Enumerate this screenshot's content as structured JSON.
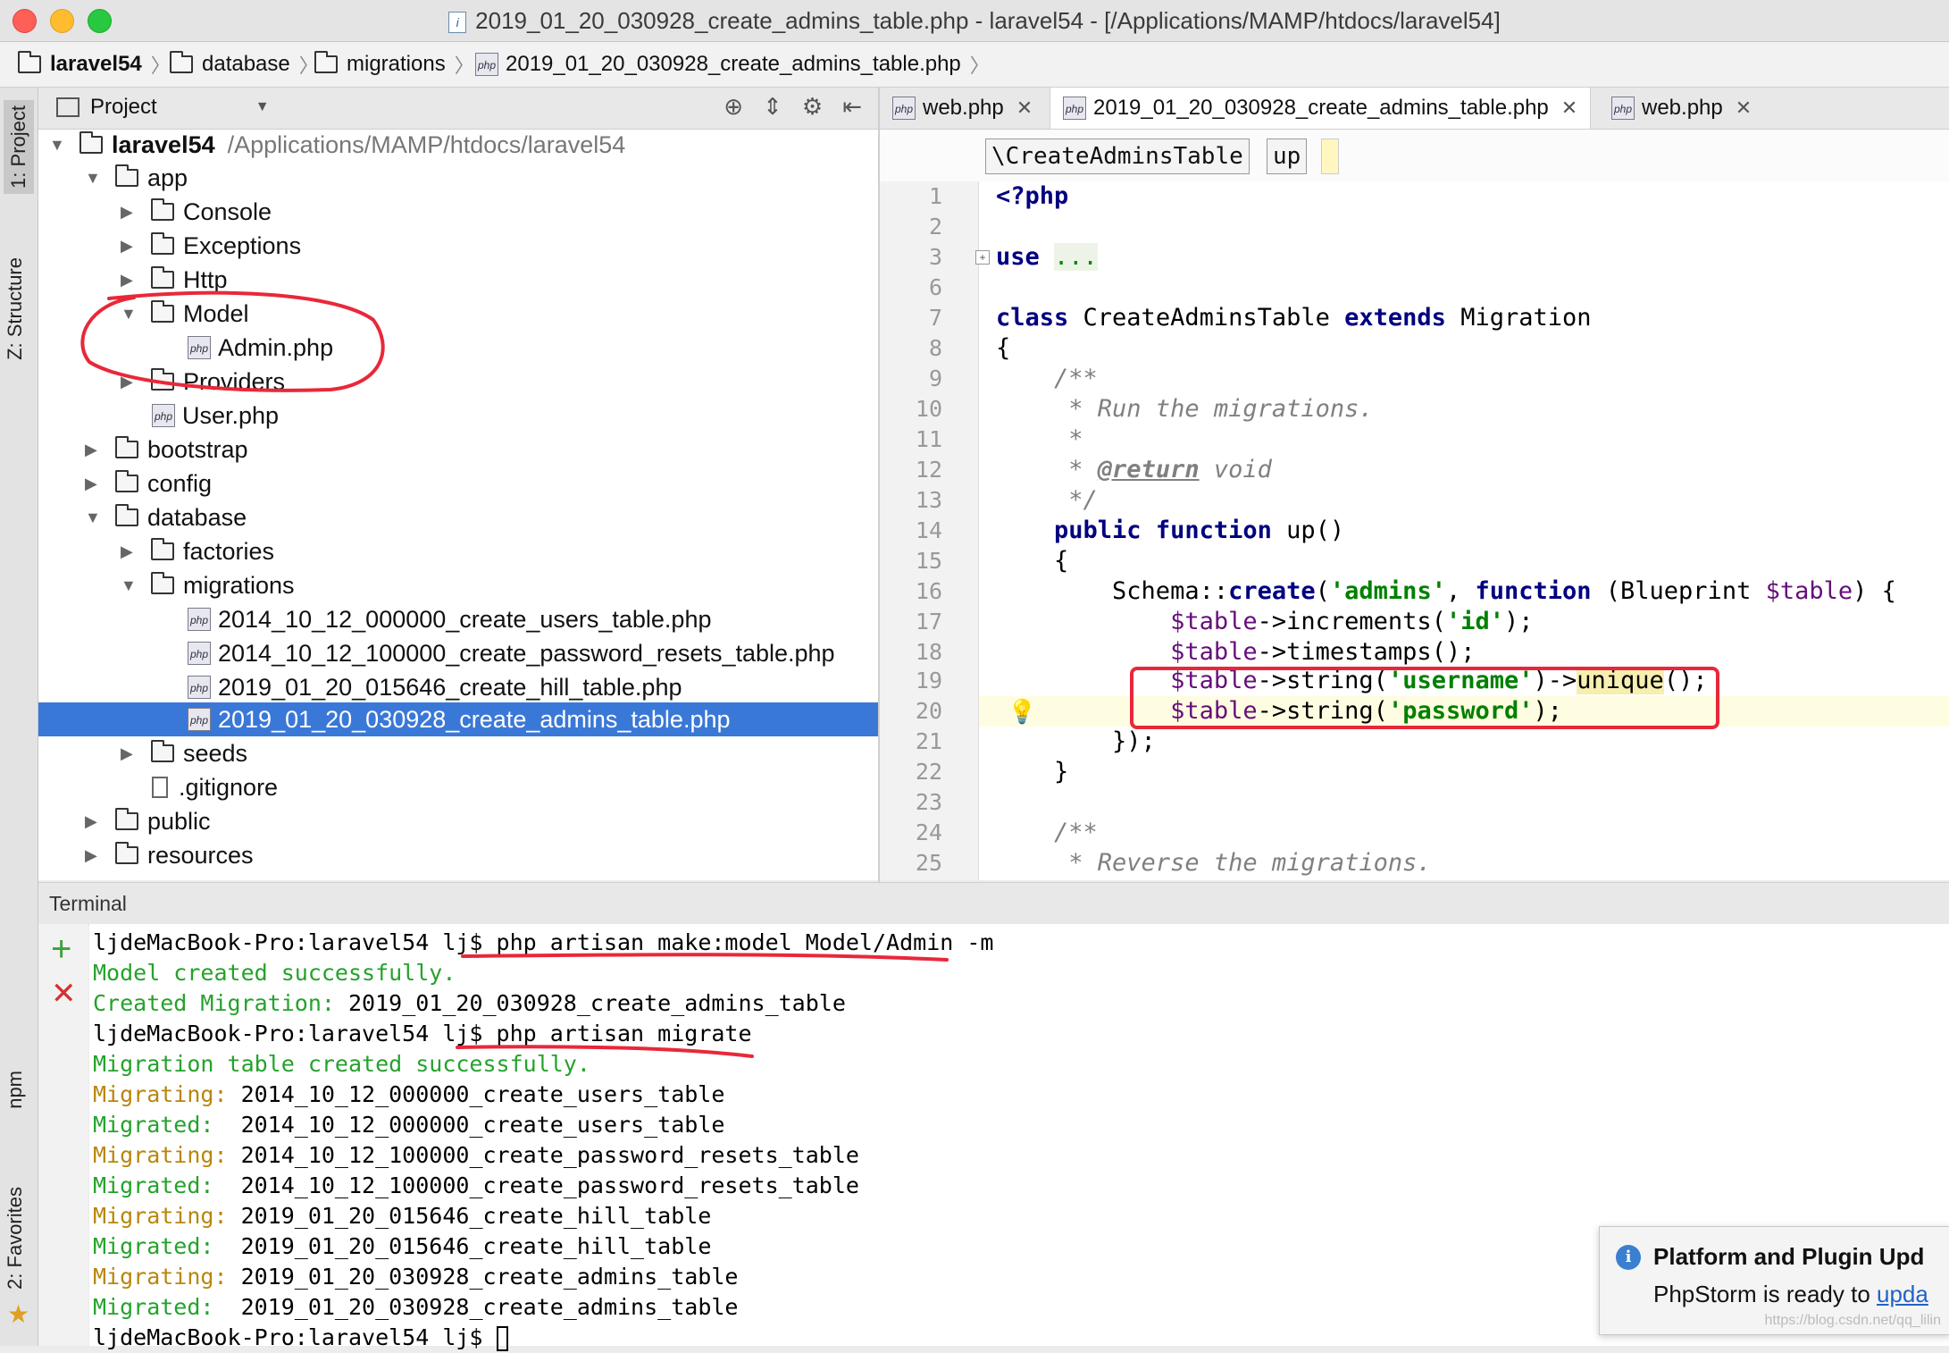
{
  "window": {
    "title": "2019_01_20_030928_create_admins_table.php - laravel54 - [/Applications/MAMP/htdocs/laravel54]"
  },
  "breadcrumb": [
    "laravel54",
    "database",
    "migrations",
    "2019_01_20_030928_create_admins_table.php"
  ],
  "left_stripe": {
    "project": "1: Project",
    "structure": "Z: Structure",
    "npm": "npm",
    "favorites": "2: Favorites"
  },
  "project_panel": {
    "title": "Project",
    "root": {
      "name": "laravel54",
      "path": "/Applications/MAMP/htdocs/laravel54"
    },
    "items": [
      {
        "label": "app",
        "kind": "folder",
        "expanded": true
      },
      {
        "label": "Console",
        "kind": "folder",
        "expanded": false
      },
      {
        "label": "Exceptions",
        "kind": "folder",
        "expanded": false
      },
      {
        "label": "Http",
        "kind": "folder",
        "expanded": false
      },
      {
        "label": "Model",
        "kind": "folder",
        "expanded": true
      },
      {
        "label": "Admin.php",
        "kind": "php"
      },
      {
        "label": "Providers",
        "kind": "folder",
        "expanded": false
      },
      {
        "label": "User.php",
        "kind": "php"
      },
      {
        "label": "bootstrap",
        "kind": "folder",
        "expanded": false
      },
      {
        "label": "config",
        "kind": "folder",
        "expanded": false
      },
      {
        "label": "database",
        "kind": "folder",
        "expanded": true
      },
      {
        "label": "factories",
        "kind": "folder",
        "expanded": false
      },
      {
        "label": "migrations",
        "kind": "folder",
        "expanded": true
      },
      {
        "label": "2014_10_12_000000_create_users_table.php",
        "kind": "php"
      },
      {
        "label": "2014_10_12_100000_create_password_resets_table.php",
        "kind": "php"
      },
      {
        "label": "2019_01_20_015646_create_hill_table.php",
        "kind": "php"
      },
      {
        "label": "2019_01_20_030928_create_admins_table.php",
        "kind": "php",
        "selected": true
      },
      {
        "label": "seeds",
        "kind": "folder",
        "expanded": false
      },
      {
        "label": ".gitignore",
        "kind": "file"
      },
      {
        "label": "public",
        "kind": "folder",
        "expanded": false
      },
      {
        "label": "resources",
        "kind": "folder",
        "expanded": false
      }
    ]
  },
  "editor": {
    "tabs": [
      {
        "label": "web.php",
        "active": false
      },
      {
        "label": "2019_01_20_030928_create_admins_table.php",
        "active": true
      },
      {
        "label": "web.php",
        "active": false
      }
    ],
    "code_breadcrumb": [
      "\\CreateAdminsTable",
      "up"
    ],
    "line_numbers": [
      "1",
      "2",
      "3",
      "6",
      "7",
      "8",
      "9",
      "10",
      "11",
      "12",
      "13",
      "14",
      "15",
      "16",
      "17",
      "18",
      "19",
      "20",
      "21",
      "22",
      "23",
      "24",
      "25"
    ],
    "current_line": "20"
  },
  "terminal": {
    "title": "Terminal",
    "lines": [
      {
        "prompt": "ljdeMacBook-Pro:laravel54 lj$ ",
        "cmd": "php artisan make:model Model/Admin -m"
      },
      {
        "green": "Model created successfully."
      },
      {
        "green": "Created Migration:",
        "rest": " 2019_01_20_030928_create_admins_table"
      },
      {
        "prompt": "ljdeMacBook-Pro:laravel54 lj$ ",
        "cmd": "php artisan migrate"
      },
      {
        "green": "Migration table created successfully."
      },
      {
        "orange": "Migrating:",
        "rest": " 2014_10_12_000000_create_users_table"
      },
      {
        "green": "Migrated:",
        "rest": "  2014_10_12_000000_create_users_table"
      },
      {
        "orange": "Migrating:",
        "rest": " 2014_10_12_100000_create_password_resets_table"
      },
      {
        "green": "Migrated:",
        "rest": "  2014_10_12_100000_create_password_resets_table"
      },
      {
        "orange": "Migrating:",
        "rest": " 2019_01_20_015646_create_hill_table"
      },
      {
        "green": "Migrated:",
        "rest": "  2019_01_20_015646_create_hill_table"
      },
      {
        "orange": "Migrating:",
        "rest": " 2019_01_20_030928_create_admins_table"
      },
      {
        "green": "Migrated:",
        "rest": "  2019_01_20_030928_create_admins_table"
      },
      {
        "prompt": "ljdeMacBook-Pro:laravel54 lj$ ",
        "cmd": ""
      }
    ]
  },
  "notification": {
    "title": "Platform and Plugin Upd",
    "body": "PhpStorm is ready to ",
    "link": "upda"
  },
  "watermark": "https://blog.csdn.net/qq_lilin",
  "colors": {
    "selection": "#3a78d8",
    "annotation": "#e8283a",
    "terminal_green": "#24a22b",
    "terminal_orange": "#b8860b"
  }
}
